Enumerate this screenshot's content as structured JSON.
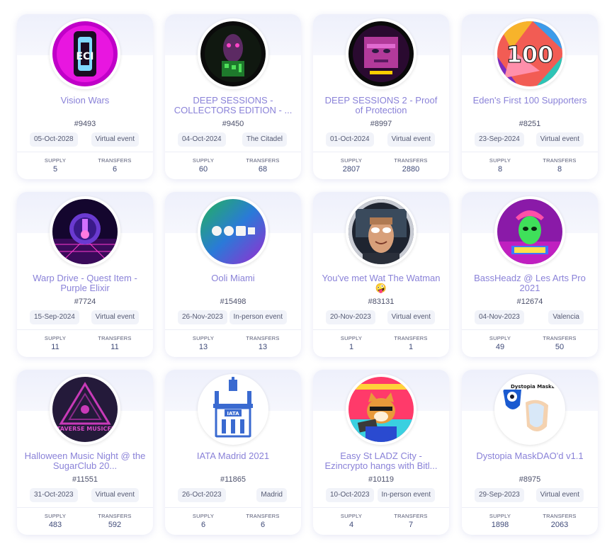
{
  "labels": {
    "supply": "SUPPLY",
    "transfers": "TRANSFERS"
  },
  "cards": [
    {
      "title": "Vision Wars",
      "id": "#9493",
      "date": "05-Oct-2028",
      "location": "Virtual event",
      "supply": "5",
      "transfers": "6",
      "art": "vision-wars-art",
      "art_text": "ECI"
    },
    {
      "title": "DEEP SESSIONS - COLLECTORS EDITION - ...",
      "id": "#9450",
      "date": "04-Oct-2024",
      "location": "The Citadel",
      "supply": "60",
      "transfers": "68",
      "art": "deep-sessions-collectors-art",
      "art_text": ""
    },
    {
      "title": "DEEP SESSIONS 2 - Proof of Protection",
      "id": "#8997",
      "date": "01-Oct-2024",
      "location": "Virtual event",
      "supply": "2807",
      "transfers": "2880",
      "art": "deep-sessions-2-art",
      "art_text": ""
    },
    {
      "title": "Eden's First 100 Supporters",
      "id": "#8251",
      "date": "23-Sep-2024",
      "location": "Virtual event",
      "supply": "8",
      "transfers": "8",
      "art": "eden-100-art",
      "art_text": "100"
    },
    {
      "title": "Warp Drive - Quest Item - Purple Elixir",
      "id": "#7724",
      "date": "15-Sep-2024",
      "location": "Virtual event",
      "supply": "11",
      "transfers": "11",
      "art": "purple-elixir-art",
      "art_text": ""
    },
    {
      "title": "Ooli Miami",
      "id": "#15498",
      "date": "26-Nov-2023",
      "location": "In-person event",
      "supply": "13",
      "transfers": "13",
      "art": "ooli-miami-art",
      "art_text": ""
    },
    {
      "title": "You've met Wat The Watman 🤪",
      "id": "#83131",
      "date": "20-Nov-2023",
      "location": "Virtual event",
      "supply": "1",
      "transfers": "1",
      "art": "watman-art",
      "art_text": ""
    },
    {
      "title": "BassHeadz @ Les Arts Pro 2021",
      "id": "#12674",
      "date": "04-Nov-2023",
      "location": "Valencia",
      "supply": "49",
      "transfers": "50",
      "art": "bassheadz-art",
      "art_text": ""
    },
    {
      "title": "Halloween Music Night @ the SugarClub 20...",
      "id": "#11551",
      "date": "31-Oct-2023",
      "location": "Virtual event",
      "supply": "483",
      "transfers": "592",
      "art": "metaverse-musicfest-art",
      "art_text": "METAVERSE MUSICFEST"
    },
    {
      "title": "IATA Madrid 2021",
      "id": "#11865",
      "date": "26-Oct-2023",
      "location": "Madrid",
      "supply": "6",
      "transfers": "6",
      "art": "iata-madrid-art",
      "art_text": "IATA"
    },
    {
      "title": "Easy St LADZ City - Ezincrypto hangs with Bitl...",
      "id": "#10119",
      "date": "10-Oct-2023",
      "location": "In-person event",
      "supply": "4",
      "transfers": "7",
      "art": "ladz-city-art",
      "art_text": ""
    },
    {
      "title": "Dystopia MaskDAO'd v1.1",
      "id": "#8975",
      "date": "29-Sep-2023",
      "location": "Virtual event",
      "supply": "1898",
      "transfers": "2063",
      "art": "dystopia-maskdao-art",
      "art_text": "Dystopia MaskDAO'd"
    }
  ],
  "colors": {
    "title": "#8a82d8",
    "accent_bg": "#eef0fb",
    "pill_bg": "#f1f3f9",
    "value": "#3f4a78"
  }
}
